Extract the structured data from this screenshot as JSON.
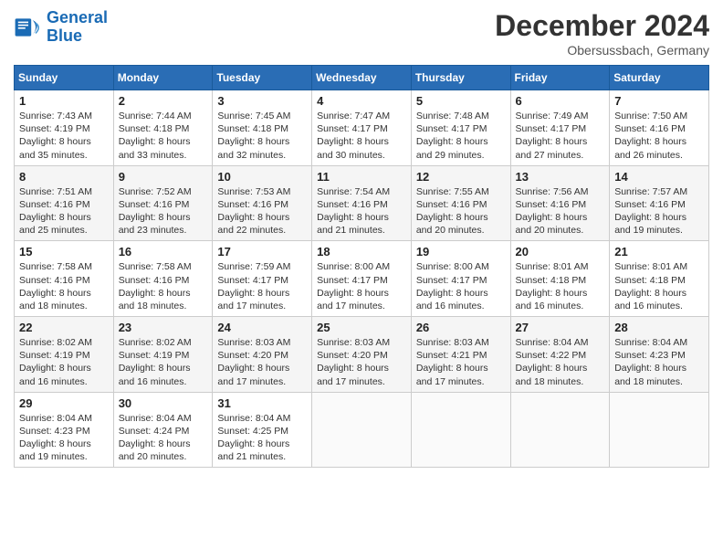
{
  "header": {
    "logo_line1": "General",
    "logo_line2": "Blue",
    "month": "December 2024",
    "location": "Obersussbach, Germany"
  },
  "weekdays": [
    "Sunday",
    "Monday",
    "Tuesday",
    "Wednesday",
    "Thursday",
    "Friday",
    "Saturday"
  ],
  "weeks": [
    [
      {
        "day": "1",
        "sunrise": "7:43 AM",
        "sunset": "4:19 PM",
        "daylight": "8 hours and 35 minutes."
      },
      {
        "day": "2",
        "sunrise": "7:44 AM",
        "sunset": "4:18 PM",
        "daylight": "8 hours and 33 minutes."
      },
      {
        "day": "3",
        "sunrise": "7:45 AM",
        "sunset": "4:18 PM",
        "daylight": "8 hours and 32 minutes."
      },
      {
        "day": "4",
        "sunrise": "7:47 AM",
        "sunset": "4:17 PM",
        "daylight": "8 hours and 30 minutes."
      },
      {
        "day": "5",
        "sunrise": "7:48 AM",
        "sunset": "4:17 PM",
        "daylight": "8 hours and 29 minutes."
      },
      {
        "day": "6",
        "sunrise": "7:49 AM",
        "sunset": "4:17 PM",
        "daylight": "8 hours and 27 minutes."
      },
      {
        "day": "7",
        "sunrise": "7:50 AM",
        "sunset": "4:16 PM",
        "daylight": "8 hours and 26 minutes."
      }
    ],
    [
      {
        "day": "8",
        "sunrise": "7:51 AM",
        "sunset": "4:16 PM",
        "daylight": "8 hours and 25 minutes."
      },
      {
        "day": "9",
        "sunrise": "7:52 AM",
        "sunset": "4:16 PM",
        "daylight": "8 hours and 23 minutes."
      },
      {
        "day": "10",
        "sunrise": "7:53 AM",
        "sunset": "4:16 PM",
        "daylight": "8 hours and 22 minutes."
      },
      {
        "day": "11",
        "sunrise": "7:54 AM",
        "sunset": "4:16 PM",
        "daylight": "8 hours and 21 minutes."
      },
      {
        "day": "12",
        "sunrise": "7:55 AM",
        "sunset": "4:16 PM",
        "daylight": "8 hours and 20 minutes."
      },
      {
        "day": "13",
        "sunrise": "7:56 AM",
        "sunset": "4:16 PM",
        "daylight": "8 hours and 20 minutes."
      },
      {
        "day": "14",
        "sunrise": "7:57 AM",
        "sunset": "4:16 PM",
        "daylight": "8 hours and 19 minutes."
      }
    ],
    [
      {
        "day": "15",
        "sunrise": "7:58 AM",
        "sunset": "4:16 PM",
        "daylight": "8 hours and 18 minutes."
      },
      {
        "day": "16",
        "sunrise": "7:58 AM",
        "sunset": "4:16 PM",
        "daylight": "8 hours and 18 minutes."
      },
      {
        "day": "17",
        "sunrise": "7:59 AM",
        "sunset": "4:17 PM",
        "daylight": "8 hours and 17 minutes."
      },
      {
        "day": "18",
        "sunrise": "8:00 AM",
        "sunset": "4:17 PM",
        "daylight": "8 hours and 17 minutes."
      },
      {
        "day": "19",
        "sunrise": "8:00 AM",
        "sunset": "4:17 PM",
        "daylight": "8 hours and 16 minutes."
      },
      {
        "day": "20",
        "sunrise": "8:01 AM",
        "sunset": "4:18 PM",
        "daylight": "8 hours and 16 minutes."
      },
      {
        "day": "21",
        "sunrise": "8:01 AM",
        "sunset": "4:18 PM",
        "daylight": "8 hours and 16 minutes."
      }
    ],
    [
      {
        "day": "22",
        "sunrise": "8:02 AM",
        "sunset": "4:19 PM",
        "daylight": "8 hours and 16 minutes."
      },
      {
        "day": "23",
        "sunrise": "8:02 AM",
        "sunset": "4:19 PM",
        "daylight": "8 hours and 16 minutes."
      },
      {
        "day": "24",
        "sunrise": "8:03 AM",
        "sunset": "4:20 PM",
        "daylight": "8 hours and 17 minutes."
      },
      {
        "day": "25",
        "sunrise": "8:03 AM",
        "sunset": "4:20 PM",
        "daylight": "8 hours and 17 minutes."
      },
      {
        "day": "26",
        "sunrise": "8:03 AM",
        "sunset": "4:21 PM",
        "daylight": "8 hours and 17 minutes."
      },
      {
        "day": "27",
        "sunrise": "8:04 AM",
        "sunset": "4:22 PM",
        "daylight": "8 hours and 18 minutes."
      },
      {
        "day": "28",
        "sunrise": "8:04 AM",
        "sunset": "4:23 PM",
        "daylight": "8 hours and 18 minutes."
      }
    ],
    [
      {
        "day": "29",
        "sunrise": "8:04 AM",
        "sunset": "4:23 PM",
        "daylight": "8 hours and 19 minutes."
      },
      {
        "day": "30",
        "sunrise": "8:04 AM",
        "sunset": "4:24 PM",
        "daylight": "8 hours and 20 minutes."
      },
      {
        "day": "31",
        "sunrise": "8:04 AM",
        "sunset": "4:25 PM",
        "daylight": "8 hours and 21 minutes."
      },
      null,
      null,
      null,
      null
    ]
  ],
  "labels": {
    "sunrise": "Sunrise:",
    "sunset": "Sunset:",
    "daylight": "Daylight:"
  }
}
